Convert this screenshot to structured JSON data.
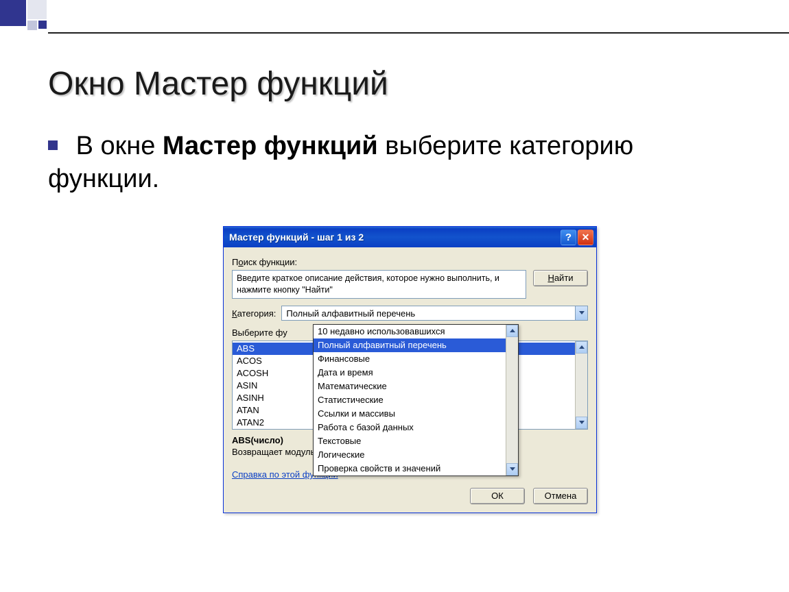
{
  "slide": {
    "title": "Окно Мастер функций",
    "body_prefix": "В окне ",
    "body_bold": "Мастер функций",
    "body_suffix": " выберите категорию функции."
  },
  "dialog": {
    "title": "Мастер функций - шаг 1 из 2",
    "search_label": "Поиск функции:",
    "search_label_u": "о",
    "search_value": "Введите краткое описание действия, которое нужно выполнить, и нажмите кнопку \"Найти\"",
    "find_button": "Найти",
    "find_u": "Н",
    "category_label": "Категория:",
    "category_u": "К",
    "category_value": "Полный алфавитный перечень",
    "select_label": "Выберите функцию:",
    "select_visible": "Выберите фу",
    "functions": [
      "ABS",
      "ACOS",
      "ACOSH",
      "ASIN",
      "ASINH",
      "ATAN",
      "ATAN2"
    ],
    "categories": [
      "10 недавно использовавшихся",
      "Полный алфавитный перечень",
      "Финансовые",
      "Дата и время",
      "Математические",
      "Статистические",
      "Ссылки и массивы",
      "Работа с базой данных",
      "Текстовые",
      "Логические",
      "Проверка свойств и значений"
    ],
    "selected_category_index": 1,
    "desc_title": "ABS(число)",
    "desc": "Возвращает модуль (абсолютную величину) числа.",
    "help_link": "Справка по этой функции",
    "ok": "ОК",
    "cancel": "Отмена"
  }
}
